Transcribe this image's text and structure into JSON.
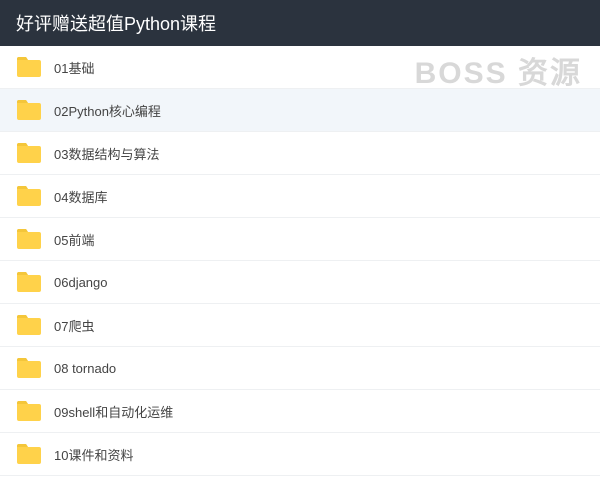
{
  "header": {
    "title": "好评赠送超值Python课程"
  },
  "watermark": "BOSS 资源",
  "files": [
    {
      "name": "01基础",
      "selected": false
    },
    {
      "name": "02Python核心编程",
      "selected": true
    },
    {
      "name": "03数据结构与算法",
      "selected": false
    },
    {
      "name": "04数据库",
      "selected": false
    },
    {
      "name": "05前端",
      "selected": false
    },
    {
      "name": "06django",
      "selected": false
    },
    {
      "name": "07爬虫",
      "selected": false
    },
    {
      "name": "08 tornado",
      "selected": false
    },
    {
      "name": "09shell和自动化运维",
      "selected": false
    },
    {
      "name": "10课件和资料",
      "selected": false
    }
  ],
  "colors": {
    "folder_fill": "#ffd24a",
    "folder_tab": "#f4c63a"
  }
}
